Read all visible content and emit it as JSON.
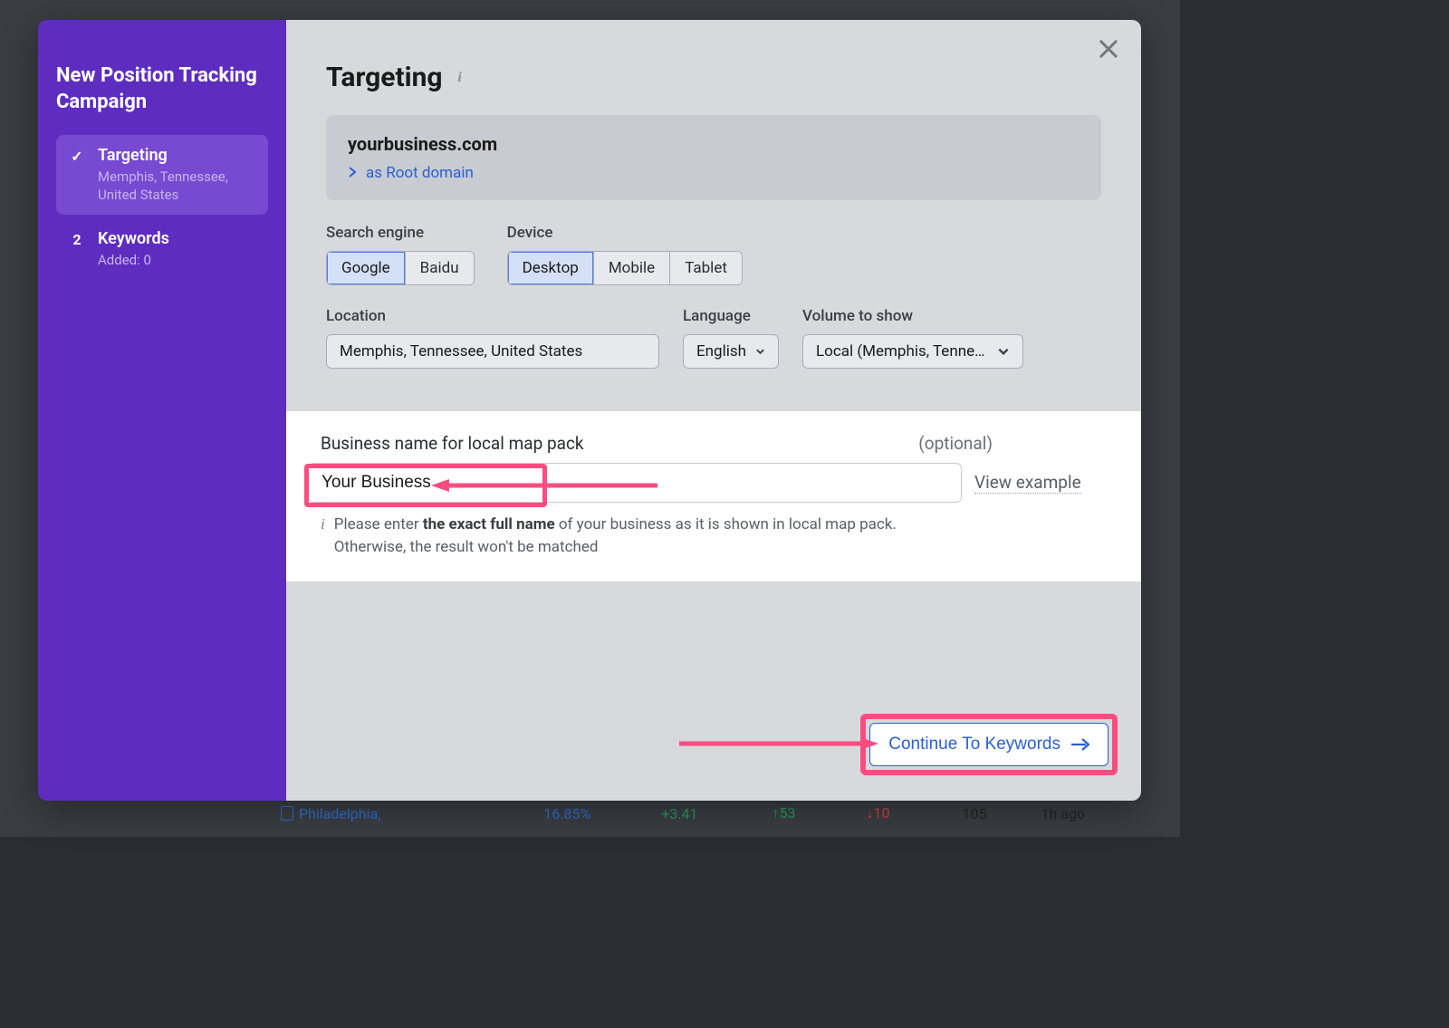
{
  "sidebar": {
    "title": "New Position Tracking Campaign",
    "steps": [
      {
        "icon": "✓",
        "label": "Targeting",
        "sub": "Memphis, Tennessee, United States"
      },
      {
        "icon": "2",
        "label": "Keywords",
        "sub": "Added: 0"
      }
    ]
  },
  "page": {
    "title": "Targeting"
  },
  "domain": {
    "name": "yourbusiness.com",
    "type_label": "as Root domain"
  },
  "search_engine": {
    "label": "Search engine",
    "options": [
      "Google",
      "Baidu"
    ],
    "selected": "Google"
  },
  "device": {
    "label": "Device",
    "options": [
      "Desktop",
      "Mobile",
      "Tablet"
    ],
    "selected": "Desktop"
  },
  "location": {
    "label": "Location",
    "value": "Memphis, Tennessee, United States"
  },
  "language": {
    "label": "Language",
    "value": "English"
  },
  "volume": {
    "label": "Volume to show",
    "value": "Local (Memphis, Tenne…"
  },
  "business_name": {
    "label": "Business name for local map pack",
    "optional": "(optional)",
    "value": "Your Business",
    "view_example": "View example",
    "hint_pre": "Please enter ",
    "hint_bold": "the exact full name",
    "hint_post": " of your business as it is shown in local map pack. Otherwise, the result won't be matched"
  },
  "continue_label": "Continue To Keywords",
  "bg_row": {
    "city": "Philadelphia,",
    "pct": "16.85%",
    "delta": "+3.41",
    "up": "53",
    "down": "10",
    "count": "105",
    "ago": "1h ago"
  }
}
